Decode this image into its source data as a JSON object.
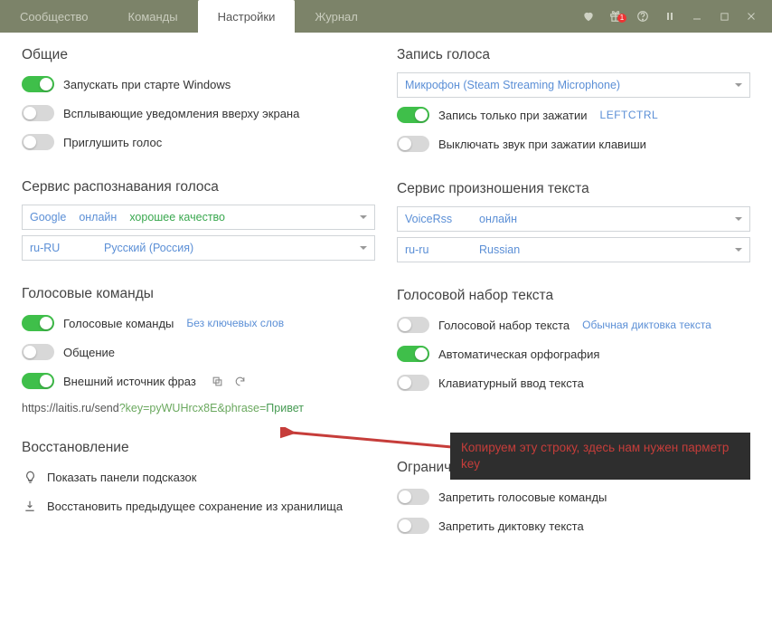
{
  "tabs": {
    "community": "Сообщество",
    "teams": "Команды",
    "settings": "Настройки",
    "journal": "Журнал"
  },
  "titlebar": {
    "badge": "1"
  },
  "left": {
    "general": {
      "title": "Общие",
      "startup": "Запускать при старте Windows",
      "popups": "Всплывающие уведомления вверху экрана",
      "mute": "Приглушить голос"
    },
    "asr": {
      "title": "Сервис распознавания голоса",
      "engine": "Google",
      "mode": "онлайн",
      "quality": "хорошее качество",
      "lang_code": "ru-RU",
      "lang_name": "Русский (Россия)"
    },
    "cmds": {
      "title": "Голосовые команды",
      "vc": "Голосовые команды",
      "vc_hint": "Без ключевых слов",
      "chat": "Общение",
      "ext": "Внешний источник фраз",
      "url_base": "https://laitis.ru/send",
      "url_q": "?key=",
      "url_key": "pyWUHrcx8E",
      "url_amp": "&phrase=",
      "url_phrase": "Привет"
    },
    "restore": {
      "title": "Восстановление",
      "hints": "Показать панели подсказок",
      "rollback": "Восстановить предыдущее сохранение из хранилища"
    }
  },
  "right": {
    "rec": {
      "title": "Запись голоса",
      "mic": "Микрофон (Steam Streaming Microphone)",
      "ptt": "Запись только при зажатии",
      "ptt_key": "LEFTCTRL",
      "mute_on_key": "Выключать звук при зажатии клавиши"
    },
    "tts": {
      "title": "Сервис произношения текста",
      "engine": "VoiceRss",
      "mode": "онлайн",
      "lang_code": "ru-ru",
      "lang_name": "Russian"
    },
    "dict": {
      "title": "Голосовой набор текста",
      "vtt": "Голосовой набор текста",
      "vtt_hint": "Обычная диктовка текста",
      "spell": "Автоматическая орфография",
      "kbd": "Клавиатурный ввод текста"
    },
    "limits": {
      "title": "Ограничения",
      "deny_cmds": "Запретить голосовые команды",
      "deny_dict": "Запретить диктовку текста"
    }
  },
  "callout": "Копируем эту строку, здесь нам нужен парметр key"
}
